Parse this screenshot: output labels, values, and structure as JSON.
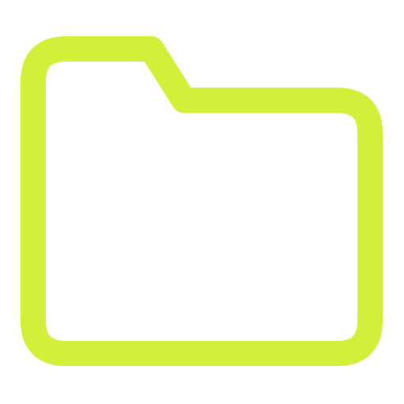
{
  "icon": {
    "name": "folder-icon",
    "stroke_color": "#D4EF3A",
    "background_color": "#FFFFFF"
  }
}
